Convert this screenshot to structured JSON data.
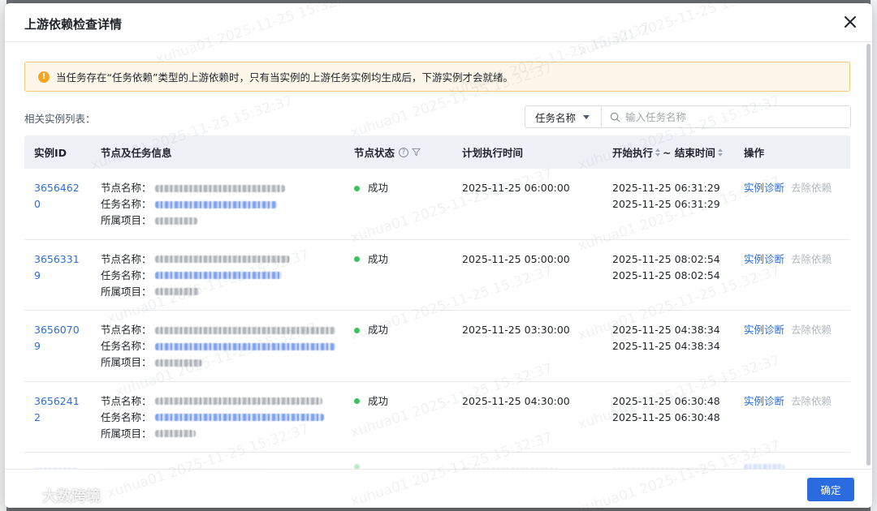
{
  "modal": {
    "title": "上游依赖检查详情",
    "alert_icon": "!",
    "alert_text": "当任务存在“任务依赖”类型的上游依赖时，只有当实例的上游任务实例均生成后，下游实例才会就绪。",
    "list_label": "相关实例列表：",
    "search": {
      "select_value": "任务名称",
      "placeholder": "输入任务名称"
    },
    "table": {
      "headers": {
        "id": "实例ID",
        "info": "节点及任务信息",
        "status": "节点状态",
        "plan_time": "计划执行时间",
        "start": "开始执行",
        "end": "~ 结束时间",
        "op": "操作"
      },
      "labels": {
        "node": "节点名称：",
        "task": "任务名称：",
        "project": "所属项目："
      },
      "rows": [
        {
          "id": "36564620",
          "status": "成功",
          "plan_time": "2025-11-25 06:00:00",
          "start": "2025-11-25 06:31:29",
          "end": "2025-11-25 06:31:29",
          "diagnose": "实例诊断",
          "remove": "去除依赖"
        },
        {
          "id": "36563319",
          "status": "成功",
          "plan_time": "2025-11-25 05:00:00",
          "start": "2025-11-25 08:02:54",
          "end": "2025-11-25 08:02:54",
          "diagnose": "实例诊断",
          "remove": "去除依赖"
        },
        {
          "id": "36560709",
          "status": "成功",
          "plan_time": "2025-11-25 03:30:00",
          "start": "2025-11-25 04:38:34",
          "end": "2025-11-25 04:38:34",
          "diagnose": "实例诊断",
          "remove": "去除依赖"
        },
        {
          "id": "36562412",
          "status": "成功",
          "plan_time": "2025-11-25 04:30:00",
          "start": "2025-11-25 06:30:48",
          "end": "2025-11-25 06:30:48",
          "diagnose": "实例诊断",
          "remove": "去除依赖"
        }
      ]
    },
    "ok_label": "确定"
  },
  "watermark_text": "xuhua01 2025-11-25 15:32:37",
  "logo_text": "大数跨境",
  "colors": {
    "primary": "#2a6ce0",
    "success": "#3fbf63",
    "warning": "#f5a524",
    "alert_bg": "#fdf7ea"
  }
}
